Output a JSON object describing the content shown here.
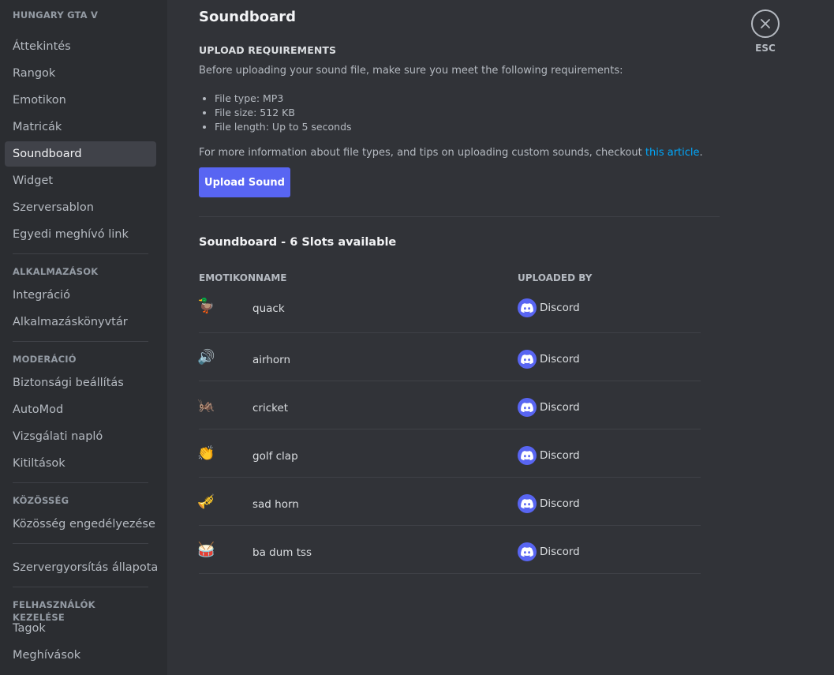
{
  "sidebar": {
    "server_header": "HUNGARY GTA V",
    "server_items": [
      "Áttekintés",
      "Rangok",
      "Emotikon",
      "Matricák",
      "Soundboard",
      "Widget",
      "Szerversablon",
      "Egyedi meghívó link"
    ],
    "active_item": "Soundboard",
    "apps_header": "ALKALMAZÁSOK",
    "apps_items": [
      "Integráció",
      "Alkalmazáskönyvtár"
    ],
    "mod_header": "MODERÁCIÓ",
    "mod_items": [
      "Biztonsági beállítás",
      "AutoMod",
      "Vizsgálati napló",
      "Kitiltások"
    ],
    "community_header": "KÖZÖSSÉG",
    "community_items": [
      "Közösség engedélyezése"
    ],
    "boost_items": [
      "Szervergyorsítás állapota"
    ],
    "users_header": "FELHASZNÁLÓK KEZELÉSE",
    "users_items": [
      "Tagok",
      "Meghívások"
    ]
  },
  "main": {
    "title": "Soundboard",
    "requirements_title": "UPLOAD REQUIREMENTS",
    "requirements_desc": "Before uploading your sound file, make sure you meet the following requirements:",
    "requirements": [
      "File type: MP3",
      "File size: 512 KB",
      "File length: Up to 5 seconds"
    ],
    "more_info_text": "For more information about file types, and tips on uploading custom sounds, checkout ",
    "more_info_link": "this article",
    "more_info_end": ".",
    "upload_button": "Upload Sound",
    "soundboard_title": "Soundboard - 6 Slots available",
    "columns": {
      "emoji": "EMOTIKON",
      "name": "NAME",
      "uploaded_by": "UPLOADED BY"
    },
    "sounds": [
      {
        "emoji": "🦆",
        "name": "quack",
        "uploader": "Discord"
      },
      {
        "emoji": "🔊",
        "name": "airhorn",
        "uploader": "Discord"
      },
      {
        "emoji": "🦗",
        "name": "cricket",
        "uploader": "Discord"
      },
      {
        "emoji": "👏",
        "name": "golf clap",
        "uploader": "Discord"
      },
      {
        "emoji": "🎺",
        "name": "sad horn",
        "uploader": "Discord"
      },
      {
        "emoji": "🥁",
        "name": "ba dum tss",
        "uploader": "Discord"
      }
    ]
  },
  "close": {
    "label": "ESC"
  },
  "colors": {
    "accent": "#5865f2",
    "link": "#00a8fc",
    "background": "#313338",
    "sidebar": "#2b2d31"
  }
}
